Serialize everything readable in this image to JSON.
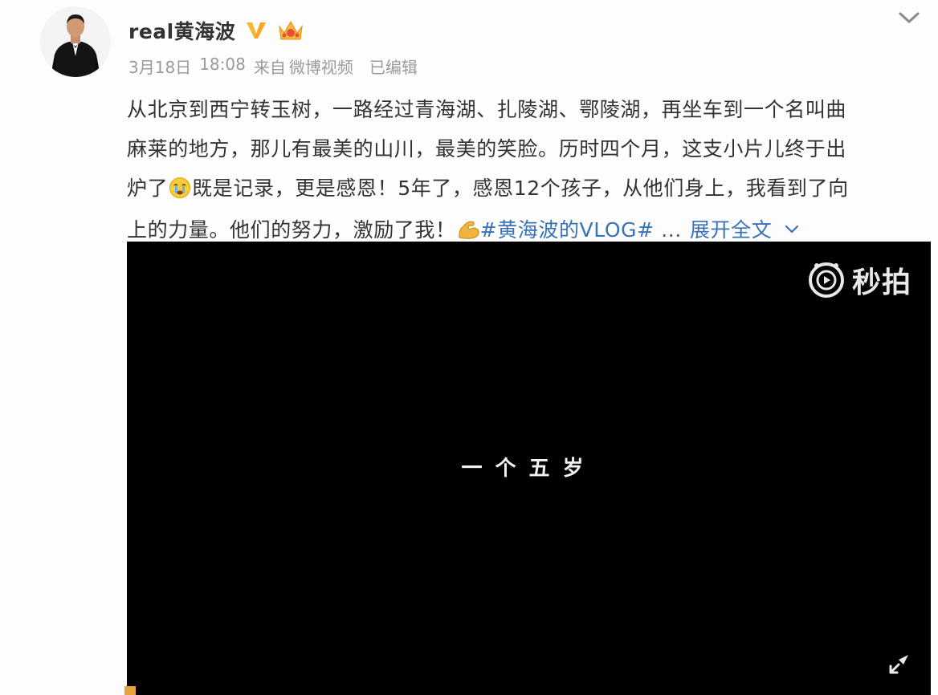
{
  "user": {
    "name": "real黄海波",
    "verified_icon": "verified-v-icon",
    "badge_icon": "crown-icon"
  },
  "meta": {
    "date": "3月18日",
    "time": "18:08",
    "from_label": "来自",
    "source": "微博视频",
    "edited": "已编辑"
  },
  "post": {
    "line1": "从北京到西宁转玉树，一路经过青海湖、扎陵湖、鄂陵湖，再坐车到一个名叫曲",
    "line2": "麻莱的地方，那儿有最美的山川，最美的笑脸。历时四个月，这支小片儿终于出",
    "line3_a": "炉了",
    "line3_b": "既是记录，更是感恩！5年了，感恩12个孩子，从他们身上，我看到了向",
    "line4_a": "上的力量。他们的努力，激励了我！",
    "hashtag": "#黄海波的VLOG#",
    "ellipsis": " ...",
    "expand": "展开全文"
  },
  "video": {
    "logo_text": "秒拍",
    "caption": "一个五岁"
  },
  "colors": {
    "link": "#3872b7",
    "text": "#333333",
    "meta": "#9a9a9a",
    "video_bg": "#000000"
  }
}
